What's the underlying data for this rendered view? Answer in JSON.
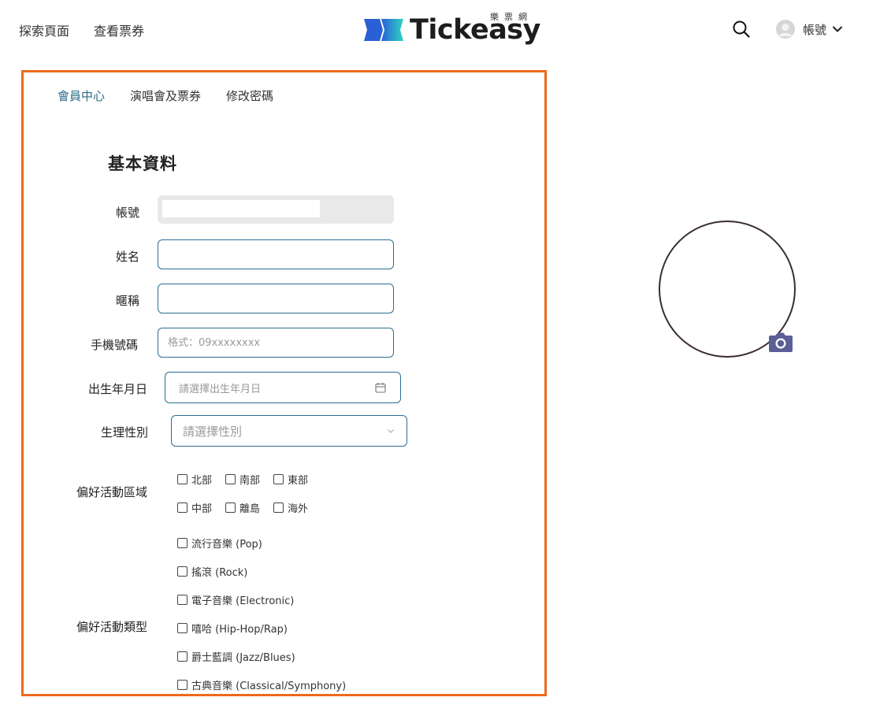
{
  "header": {
    "nav": [
      "探索頁面",
      "查看票券"
    ],
    "logo_text": "Tickeasy",
    "logo_subtext": "樂票網",
    "account_label": "帳號"
  },
  "card": {
    "tabs": [
      {
        "label": "會員中心",
        "active": true
      },
      {
        "label": "演唱會及票券",
        "active": false
      },
      {
        "label": "修改密碼",
        "active": false
      }
    ],
    "section_title": "基本資料",
    "fields": {
      "account": {
        "label": "帳號",
        "value": ""
      },
      "name": {
        "label": "姓名",
        "value": ""
      },
      "nickname": {
        "label": "暱稱",
        "value": ""
      },
      "phone": {
        "label": "手機號碼",
        "placeholder": "格式：09xxxxxxxx"
      },
      "birthday": {
        "label": "出生年月日",
        "placeholder": "請選擇出生年月日"
      },
      "gender": {
        "label": "生理性別",
        "placeholder": "請選擇性別"
      }
    },
    "regions": {
      "label": "偏好活動區域",
      "options": [
        "北部",
        "南部",
        "東部",
        "中部",
        "離島",
        "海外"
      ]
    },
    "genres": {
      "label": "偏好活動類型",
      "options": [
        "流行音樂 (Pop)",
        "搖滾 (Rock)",
        "電子音樂 (Electronic)",
        "嘻哈 (Hip-Hop/Rap)",
        "爵士藍調 (Jazz/Blues)",
        "古典音樂 (Classical/Symphony)"
      ]
    }
  },
  "colors": {
    "card_border": "#ec6a1c",
    "accent": "#2a6b8a",
    "camera": "#5b5f97",
    "logo_blue": "#1f7fd6",
    "logo_teal": "#2fd3c4"
  },
  "icons": [
    "search-icon",
    "user-icon",
    "chevron-down-icon",
    "calendar-icon",
    "camera-icon"
  ]
}
